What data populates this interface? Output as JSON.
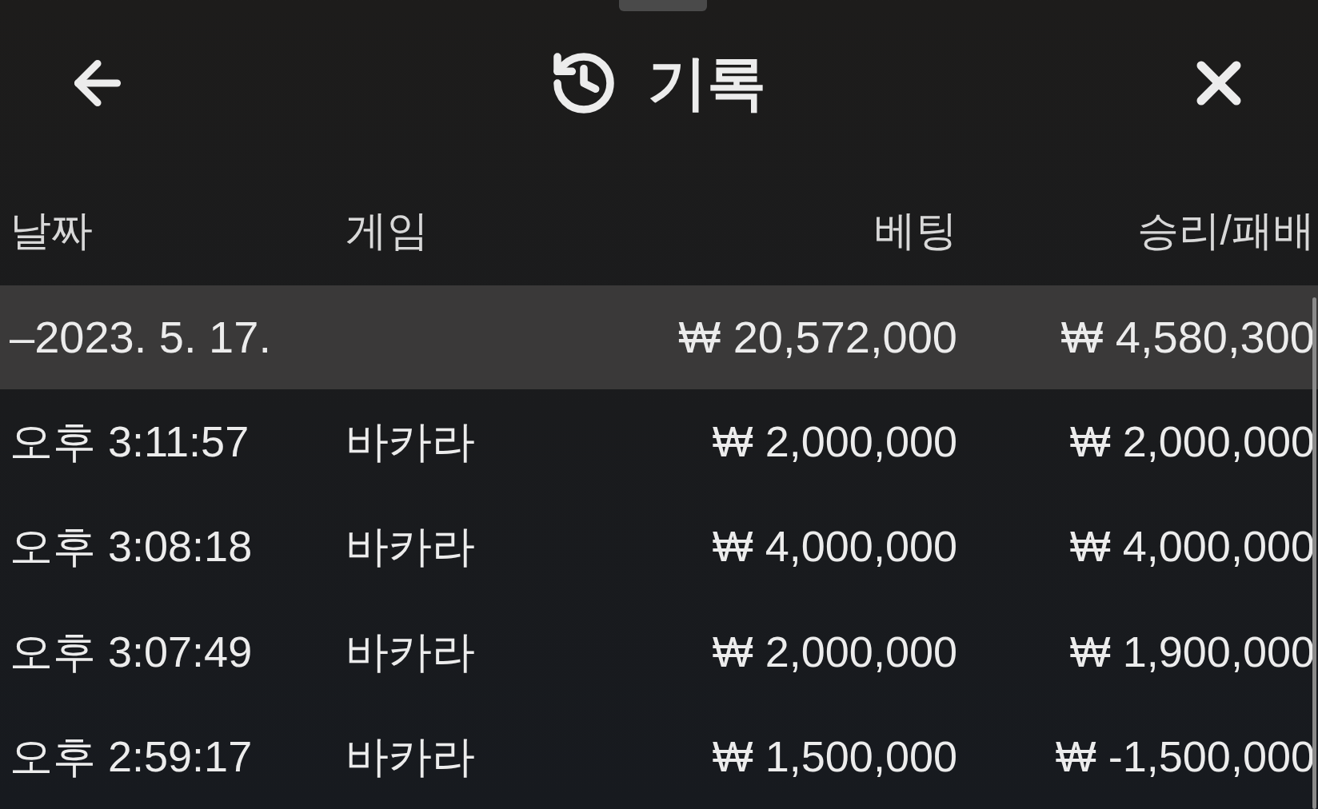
{
  "header": {
    "title": "기록"
  },
  "columns": [
    "날짜",
    "게임",
    "베팅",
    "승리/패배"
  ],
  "summary": {
    "date": "–2023. 5. 17.",
    "bet": "₩ 20,572,000",
    "result": "₩ 4,580,300"
  },
  "rows": [
    {
      "time": "오후 3:11:57",
      "game": "바카라",
      "bet": "₩ 2,000,000",
      "result": "₩ 2,000,000"
    },
    {
      "time": "오후 3:08:18",
      "game": "바카라",
      "bet": "₩ 4,000,000",
      "result": "₩ 4,000,000"
    },
    {
      "time": "오후 3:07:49",
      "game": "바카라",
      "bet": "₩ 2,000,000",
      "result": "₩ 1,900,000"
    },
    {
      "time": "오후 2:59:17",
      "game": "바카라",
      "bet": "₩ 1,500,000",
      "result": "₩ -1,500,000"
    }
  ]
}
